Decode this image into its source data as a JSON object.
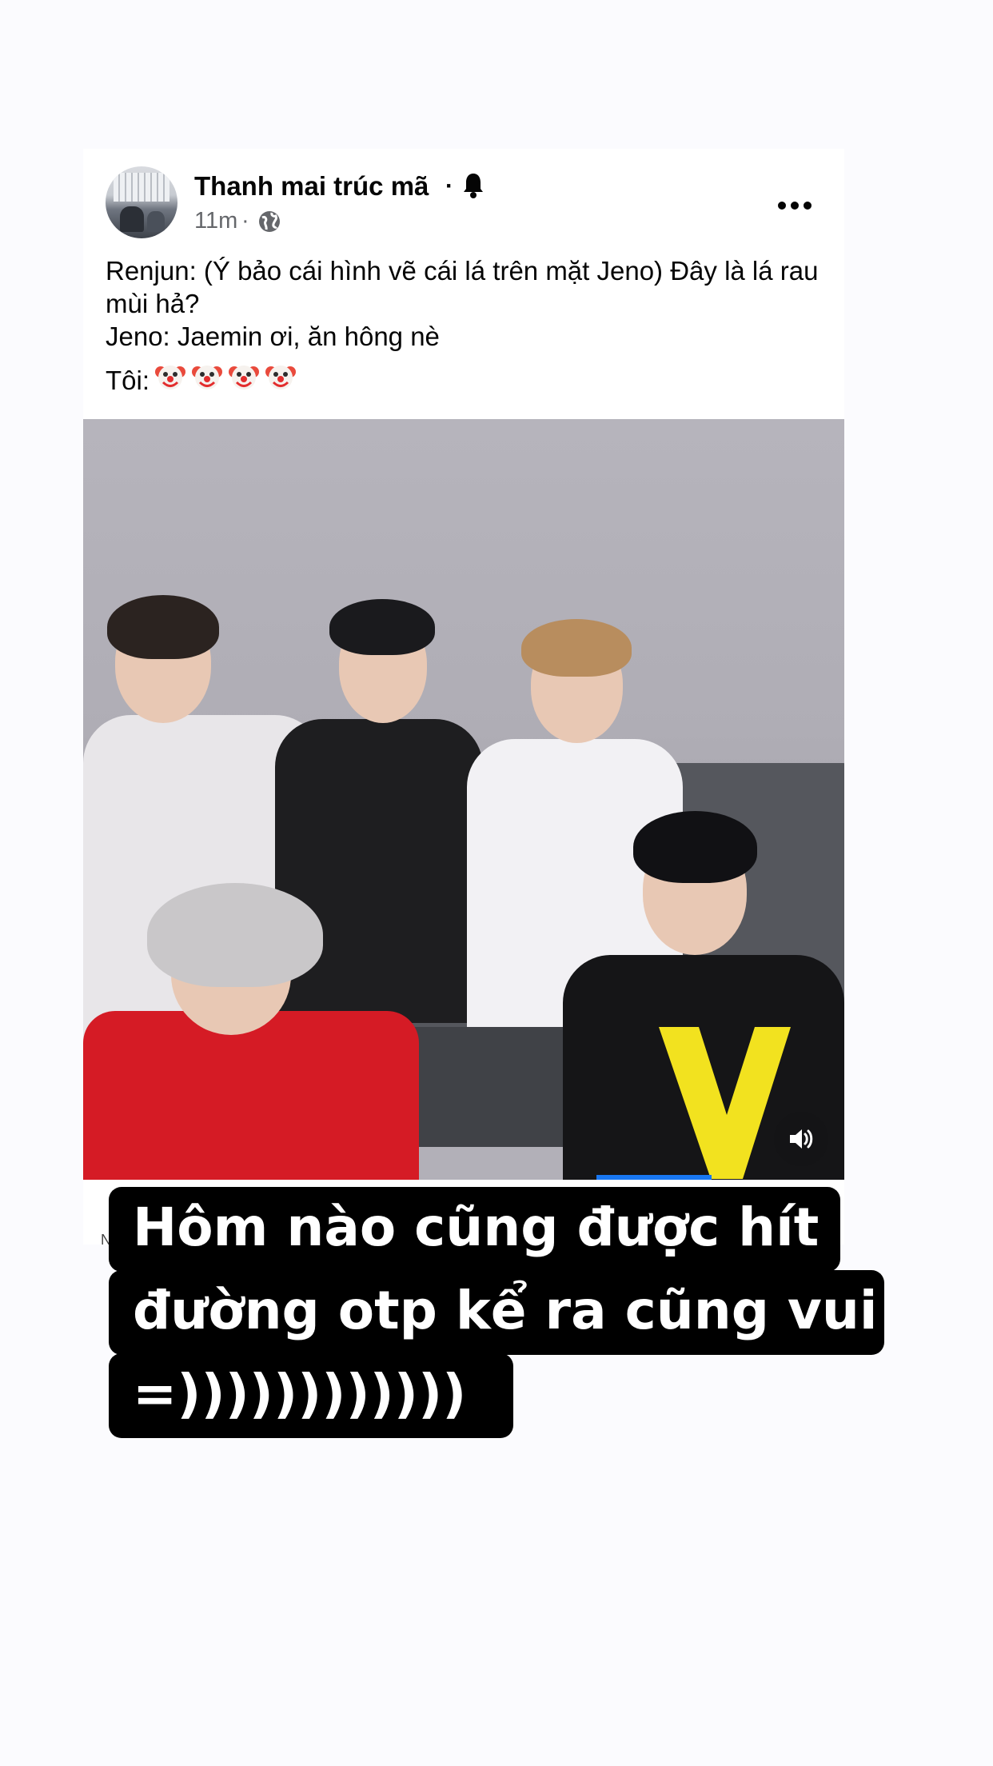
{
  "post": {
    "author": "Thanh mai trúc mã",
    "author_separator": "·",
    "time": "11m",
    "meta_separator": "·",
    "text_lines": [
      "Renjun: (Ý bảo cái hình vẽ cái lá trên mặt Jeno) Đây là lá rau mùi hả?",
      "Jeno: Jaemin ơi, ăn hông nè",
      "Tôi:"
    ],
    "reaction_emoji": "clown-face-emoji",
    "reaction_emoji_count": 4
  },
  "icons": {
    "bell": "bell-icon",
    "globe": "globe-icon",
    "more": "more-options-icon",
    "sound": "speaker-sound-on-icon"
  },
  "colors": {
    "accent": "#1877f2",
    "caption_bg": "#000000",
    "caption_text": "#ffffff"
  },
  "video": {
    "progress": 0.0
  },
  "hidden_strip_text": "N",
  "story_caption": {
    "lines": [
      "Hôm nào cũng được hít",
      "đường otp kể ra cũng vui",
      "=))))))))))))"
    ]
  }
}
